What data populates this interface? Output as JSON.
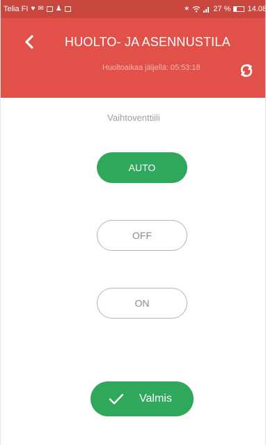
{
  "status_bar": {
    "carrier": "Telia FI",
    "signal_percent": "27 %",
    "time": "14.08",
    "notification_icons": [
      "heart-icon",
      "mail-icon",
      "facebook-icon",
      "person-icon",
      "image-icon"
    ],
    "system_icons": [
      "bluetooth-icon",
      "wifi-icon",
      "signal-icon",
      "battery-icon"
    ]
  },
  "header": {
    "title": "HUOLTO- JA ASENNUSTILA",
    "subtitle": "Huoltoaikaa jäljellä: 05:53:18",
    "colors": {
      "background": "#e15149",
      "status_bar": "#c9473f",
      "subtitle_text": "#f4b4af"
    }
  },
  "main": {
    "section_label": "Vaihtoventtiili",
    "options": [
      {
        "label": "AUTO",
        "selected": true
      },
      {
        "label": "OFF",
        "selected": false
      },
      {
        "label": "ON",
        "selected": false
      }
    ],
    "done_label": "Valmis",
    "colors": {
      "accent_green": "#2fa85c",
      "outline_gray": "#b5b5b5"
    }
  }
}
